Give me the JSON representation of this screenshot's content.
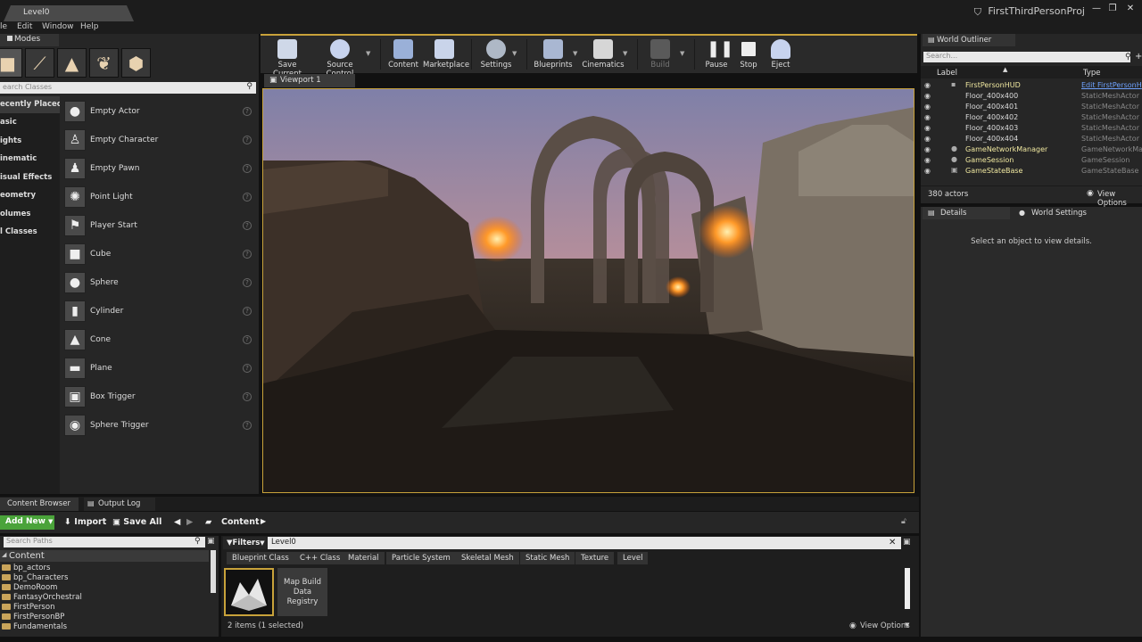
{
  "window": {
    "doc_tab": "Level0",
    "project_name": "FirstThirdPersonProj",
    "buttons": {
      "minimize": "—",
      "restore": "❐",
      "close": "✕"
    }
  },
  "menu": [
    "le",
    "Edit",
    "Window",
    "Help"
  ],
  "modes": {
    "tab_label": "Modes",
    "search_placeholder": "earch Classes",
    "categories": [
      "ecently Placed",
      "asic",
      "ights",
      "inematic",
      "isual Effects",
      "eometry",
      "olumes",
      "l Classes"
    ],
    "items": [
      "Empty Actor",
      "Empty Character",
      "Empty Pawn",
      "Point Light",
      "Player Start",
      "Cube",
      "Sphere",
      "Cylinder",
      "Cone",
      "Plane",
      "Box Trigger",
      "Sphere Trigger"
    ]
  },
  "toolbar": {
    "save_current": "Save Current",
    "source_control": "Source Control",
    "content": "Content",
    "marketplace": "Marketplace",
    "settings": "Settings",
    "blueprints": "Blueprints",
    "cinematics": "Cinematics",
    "build": "Build",
    "pause": "Pause",
    "stop": "Stop",
    "eject": "Eject"
  },
  "viewport": {
    "tab_label": "Viewport 1"
  },
  "outliner": {
    "tab_label": "World Outliner",
    "search_placeholder": "Search...",
    "col_label": "Label",
    "col_type": "Type",
    "rows": [
      {
        "label": "FirstPersonHUD",
        "type": "Edit FirstPersonH",
        "link": true
      },
      {
        "label": "Floor_400x400",
        "type": "StaticMeshActor"
      },
      {
        "label": "Floor_400x401",
        "type": "StaticMeshActor"
      },
      {
        "label": "Floor_400x402",
        "type": "StaticMeshActor"
      },
      {
        "label": "Floor_400x403",
        "type": "StaticMeshActor"
      },
      {
        "label": "Floor_400x404",
        "type": "StaticMeshActor"
      },
      {
        "label": "GameNetworkManager",
        "type": "GameNetworkMar"
      },
      {
        "label": "GameSession",
        "type": "GameSession"
      },
      {
        "label": "GameStateBase",
        "type": "GameStateBase"
      }
    ],
    "actor_count": "380 actors",
    "view_options": "View Options"
  },
  "details": {
    "tab_details": "Details",
    "tab_world_settings": "World Settings",
    "empty_message": "Select an object to view details."
  },
  "content_browser": {
    "tab_label": "Content Browser",
    "output_log_tab": "Output Log",
    "add_new": "Add New",
    "import": "Import",
    "save_all": "Save All",
    "path_root": "Content",
    "search_paths_placeholder": "Search Paths",
    "folder_root": "Content",
    "folders": [
      "bp_actors",
      "bp_Characters",
      "DemoRoom",
      "FantasyOrchestral",
      "FirstPerson",
      "FirstPersonBP",
      "Fundamentals"
    ],
    "filters_label": "Filters",
    "filter_text": "Level0",
    "chips": [
      "Blueprint Class",
      "C++ Class",
      "Material",
      "Particle System",
      "Skeletal Mesh",
      "Static Mesh",
      "Texture",
      "Level"
    ],
    "asset2_label": "Map Build Data Registry",
    "status": "2 items (1 selected)",
    "view_options": "View Options"
  },
  "colors": {
    "accent": "#c8a23a",
    "add_new": "#4aa33a",
    "link": "#6fa3ff"
  }
}
